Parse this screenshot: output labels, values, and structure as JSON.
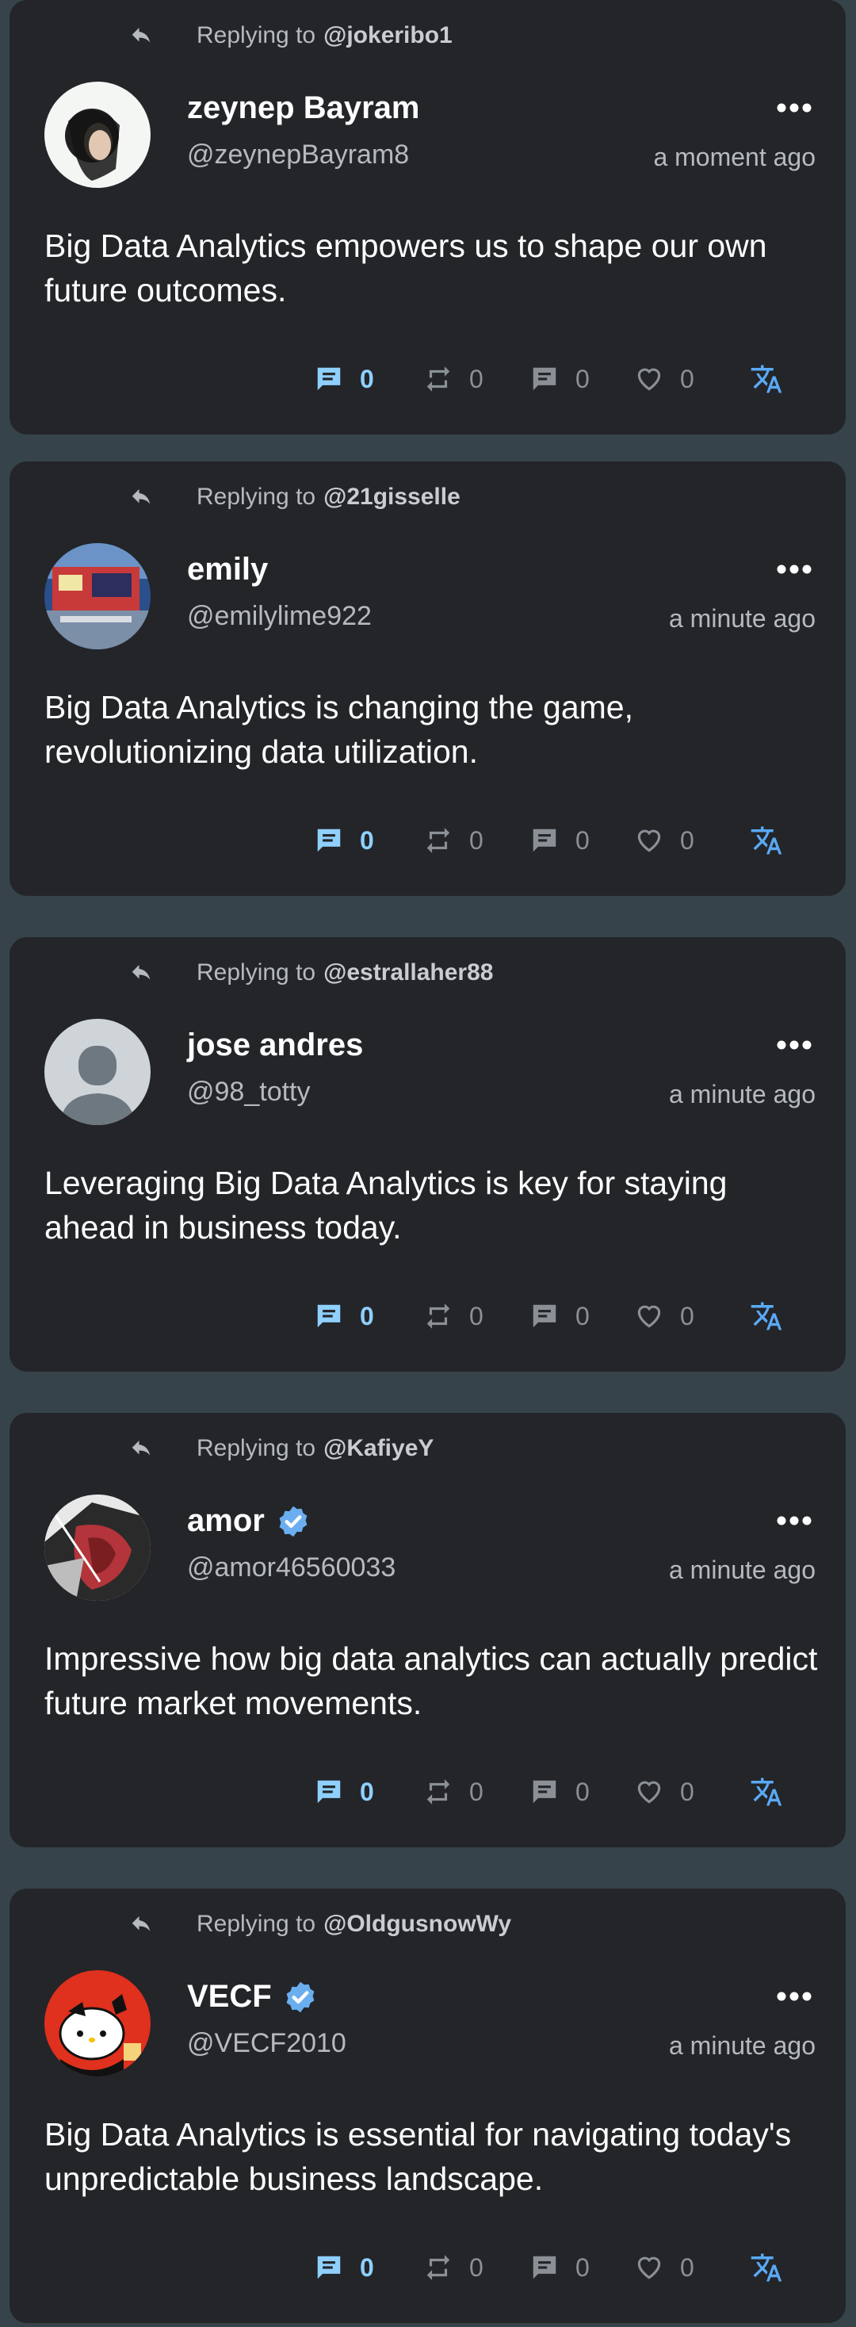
{
  "reply_prefix": "Replying to",
  "posts": [
    {
      "replying_to": "@jokeribo1",
      "display_name": "zeynep Bayram",
      "verified": false,
      "username": "@zeynepBayram8",
      "time": "a moment ago",
      "text": "Big Data Analytics empowers us to shape our own future outcomes.",
      "replies": "0",
      "retweets": "0",
      "comments": "0",
      "likes": "0"
    },
    {
      "replying_to": "@21gisselle",
      "display_name": "emily",
      "verified": false,
      "username": "@emilylime922",
      "time": "a minute ago",
      "text": "Big Data Analytics is changing the game, revolutionizing data utilization.",
      "replies": "0",
      "retweets": "0",
      "comments": "0",
      "likes": "0"
    },
    {
      "replying_to": "@estrallaher88",
      "display_name": "jose andres",
      "verified": false,
      "username": "@98_totty",
      "time": "a minute ago",
      "text": "Leveraging Big Data Analytics is key for staying ahead in business today.",
      "replies": "0",
      "retweets": "0",
      "comments": "0",
      "likes": "0"
    },
    {
      "replying_to": "@KafiyeY",
      "display_name": "amor",
      "verified": true,
      "username": "@amor46560033",
      "time": "a minute ago",
      "text": "Impressive how big data analytics can actually predict future market movements.",
      "replies": "0",
      "retweets": "0",
      "comments": "0",
      "likes": "0"
    },
    {
      "replying_to": "@OldgusnowWy",
      "display_name": "VECF",
      "verified": true,
      "username": "@VECF2010",
      "time": "a minute ago",
      "text": "Big Data Analytics is essential for navigating today's unpredictable business landscape.",
      "replies": "0",
      "retweets": "0",
      "comments": "0",
      "likes": "0"
    }
  ],
  "icons": {
    "reply_arrow": "reply-arrow-icon",
    "more": "more-options-icon",
    "verified": "verified-badge-icon",
    "reply": "reply-count-icon",
    "retweet": "retweet-icon",
    "comment": "comment-icon",
    "like": "heart-icon",
    "translate": "translate-icon"
  },
  "colors": {
    "background": "#37434a",
    "card": "#232529",
    "accent": "#8fd0ff",
    "verified": "#6aaef0",
    "muted": "#b5babf"
  }
}
